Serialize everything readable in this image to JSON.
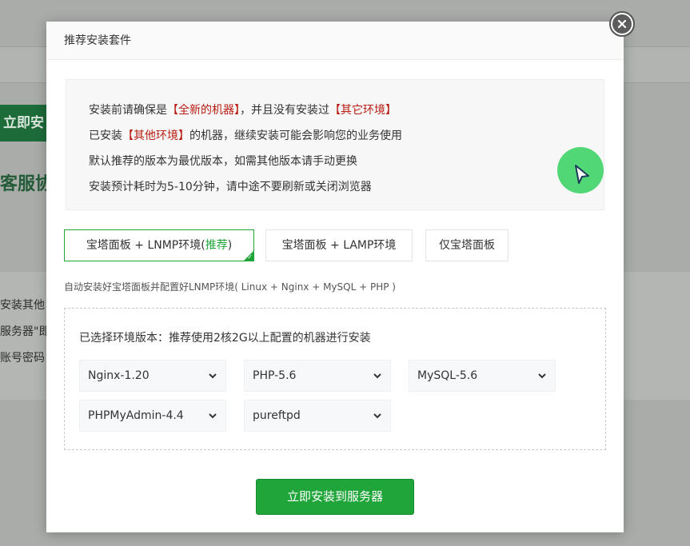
{
  "background": {
    "left_button": "立即安",
    "left_heading": "客服协",
    "left_lines": [
      "安装其他",
      "服务器\"即",
      "账号密码"
    ]
  },
  "modal": {
    "title": "推荐安装套件",
    "notice": {
      "line1_a": "安装前请确保是",
      "line1_hl1": "【全新的机器】",
      "line1_b": "，并且没有安装过",
      "line1_hl2": "【其它环境】",
      "line2_a": "已安装",
      "line2_hl": "【其他环境】",
      "line2_b": "的机器，继续安装可能会影响您的业务使用",
      "line3": "默认推荐的版本为最优版本，如需其他版本请手动更换",
      "line4": "安装预计耗时为5-10分钟，请中途不要刷新或关闭浏览器"
    },
    "tabs": [
      {
        "label_a": "宝塔面板 + LNMP环境(",
        "label_rec": "推荐",
        "label_b": ")"
      },
      {
        "label": "宝塔面板 + LAMP环境"
      },
      {
        "label": "仅宝塔面板"
      }
    ],
    "description": "自动安装好宝塔面板并配置好LNMP环境( Linux + Nginx + MySQL + PHP )",
    "versions": {
      "title": "已选择环境版本：推荐使用2核2G以上配置的机器进行安装",
      "selects": {
        "nginx": "Nginx-1.20",
        "php": "PHP-5.6",
        "mysql": "MySQL-5.6",
        "phpmyadmin": "PHPMyAdmin-4.4",
        "ftp": "pureftpd"
      }
    },
    "install_button": "立即安装到服务器"
  },
  "colors": {
    "accent": "#20a53a",
    "highlight_red": "#b81c12"
  }
}
